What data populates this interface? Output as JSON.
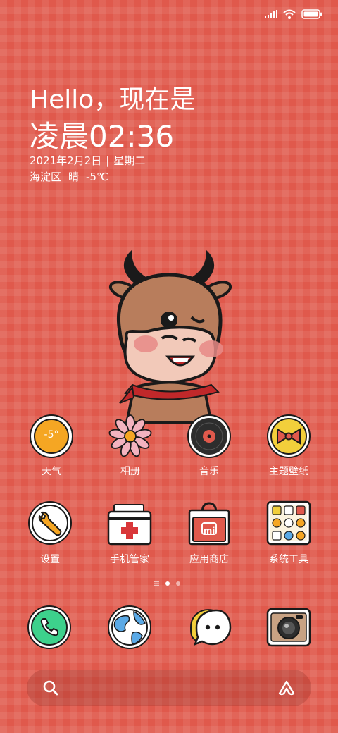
{
  "status_bar": {
    "signal": "signal-icon",
    "wifi": "wifi-icon",
    "battery": "battery-icon"
  },
  "clock_widget": {
    "greeting": "Hello，现在是",
    "time": "凌晨02:36",
    "date": "2021年2月2日",
    "weekday": "星期二",
    "district": "海淀区",
    "condition": "晴",
    "temperature": "-5℃"
  },
  "apps_row1": [
    {
      "label": "天气",
      "icon": "weather-icon",
      "badge": "-5°"
    },
    {
      "label": "相册",
      "icon": "gallery-flower-icon"
    },
    {
      "label": "音乐",
      "icon": "music-record-icon"
    },
    {
      "label": "主题壁纸",
      "icon": "theme-bow-icon"
    }
  ],
  "apps_row2": [
    {
      "label": "设置",
      "icon": "settings-wrench-icon"
    },
    {
      "label": "手机管家",
      "icon": "security-kit-icon"
    },
    {
      "label": "应用商店",
      "icon": "store-bag-icon",
      "logo": "mi"
    },
    {
      "label": "系统工具",
      "icon": "tools-grid-icon"
    }
  ],
  "dock": [
    {
      "icon": "phone-icon"
    },
    {
      "icon": "browser-globe-icon"
    },
    {
      "icon": "messages-icon"
    },
    {
      "icon": "camera-icon"
    }
  ],
  "page_indicator": {
    "pages": 2,
    "current": 1
  },
  "search_bar": {
    "left_icon": "search-icon",
    "right_icon": "assistant-icon"
  },
  "colors": {
    "background": "#e0594c",
    "text": "#ffffff"
  }
}
